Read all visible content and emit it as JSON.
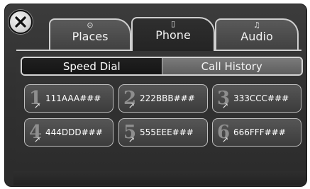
{
  "tabs": [
    {
      "label": "Places",
      "icon": "navigation-icon",
      "glyph": "⊙"
    },
    {
      "label": "Phone",
      "icon": "phone-icon",
      "glyph": "▯"
    },
    {
      "label": "Audio",
      "icon": "music-note-icon",
      "glyph": "♫"
    }
  ],
  "active_tab": "Phone",
  "segments": {
    "speed_dial": "Speed Dial",
    "call_history": "Call History",
    "selected": "Speed Dial"
  },
  "speed_dial": [
    {
      "number": "1",
      "name": "111AAA###"
    },
    {
      "number": "2",
      "name": "222BBB###"
    },
    {
      "number": "3",
      "name": "333CCC###"
    },
    {
      "number": "4",
      "name": "444DDD###"
    },
    {
      "number": "5",
      "name": "555EEE###"
    },
    {
      "number": "6",
      "name": "666FFF###"
    }
  ],
  "colors": {
    "background": "#323232",
    "accent": "#cfcfcf",
    "text": "#ffffff"
  }
}
